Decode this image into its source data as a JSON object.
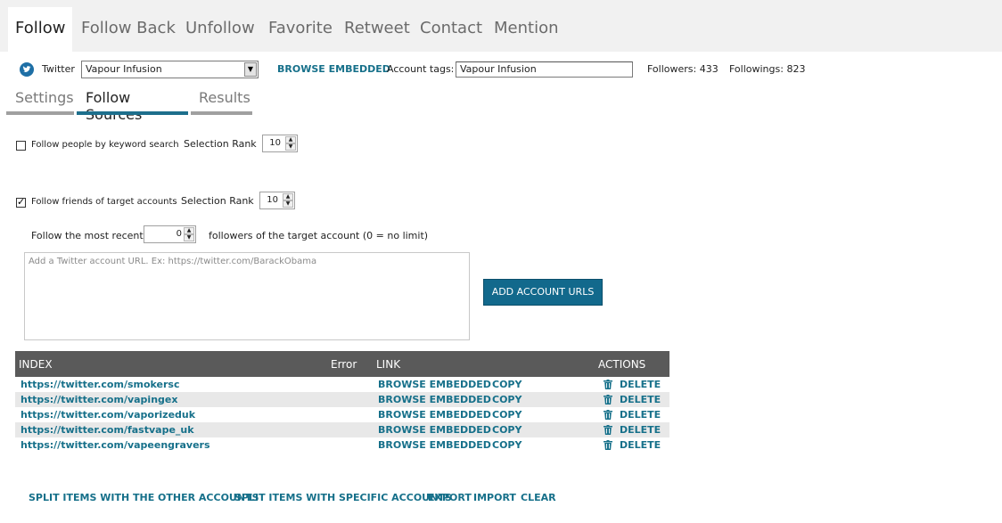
{
  "top_tabs": [
    "Follow",
    "Follow Back",
    "Unfollow",
    "Favorite",
    "Retweet",
    "Contact",
    "Mention"
  ],
  "account_bar": {
    "network_icon": "twitter-icon",
    "network_label": "Twitter",
    "account_select": "Vapour Infusion",
    "browse_embedded": "BROWSE EMBEDDED",
    "account_tags_label": "Account tags:",
    "account_tags_value": "Vapour Infusion",
    "followers": "Followers: 433",
    "followings": "Followings: 823"
  },
  "sub_tabs": [
    "Settings",
    "Follow Sources",
    "Results"
  ],
  "keyword_option": {
    "checked": false,
    "label": "Follow people by keyword search",
    "rank_label": "Selection Rank",
    "rank_value": "10"
  },
  "friends_option": {
    "checked": true,
    "label": "Follow friends of target accounts",
    "rank_label": "Selection Rank",
    "rank_value": "10"
  },
  "recent": {
    "prefix": "Follow the most recent",
    "value": "0",
    "suffix": "followers of the target account (0 = no limit)"
  },
  "url_input_placeholder": "Add a Twitter account URL. Ex: https://twitter.com/BarackObama",
  "add_button": "ADD ACCOUNT URLS",
  "table": {
    "headers": {
      "index": "INDEX",
      "error": "Error",
      "link": "LINK",
      "actions": "ACTIONS"
    },
    "rows": [
      {
        "url": "https://twitter.com/smokersc",
        "browse": "BROWSE EMBEDDED",
        "copy": "COPY",
        "delete": "DELETE"
      },
      {
        "url": "https://twitter.com/vapingex",
        "browse": "BROWSE EMBEDDED",
        "copy": "COPY",
        "delete": "DELETE"
      },
      {
        "url": "https://twitter.com/vaporizeduk",
        "browse": "BROWSE EMBEDDED",
        "copy": "COPY",
        "delete": "DELETE"
      },
      {
        "url": "https://twitter.com/fastvape_uk",
        "browse": "BROWSE EMBEDDED",
        "copy": "COPY",
        "delete": "DELETE"
      },
      {
        "url": "https://twitter.com/vapeengravers",
        "browse": "BROWSE EMBEDDED",
        "copy": "COPY",
        "delete": "DELETE"
      }
    ]
  },
  "bottom_links": [
    "SPLIT ITEMS WITH THE OTHER ACCOUNTS",
    "SPLIT ITEMS WITH SPECIFIC ACCOUNTS",
    "EXPORT",
    "IMPORT",
    "CLEAR"
  ],
  "colors": {
    "accent": "#16708a",
    "button": "#12698c",
    "header": "#5a5a5a"
  }
}
